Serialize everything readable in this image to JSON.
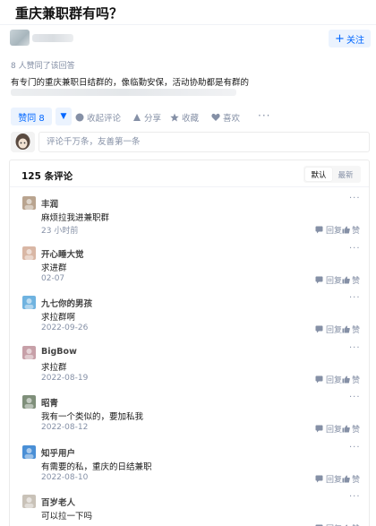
{
  "question": {
    "title": "重庆兼职群有吗？"
  },
  "author": {
    "follow_label": "关注"
  },
  "answer": {
    "vote_summary": "8 人赞同了该回答",
    "text": "有专门的重庆兼职日结群的，像临勤安保，活动协助都是有群的"
  },
  "actions": {
    "upvote_label": "赞同 8",
    "downvote_symbol": "▼",
    "collapse_comments": "收起评论",
    "share": "分享",
    "favorite": "收藏",
    "like": "喜欢",
    "more": "···"
  },
  "comment_box": {
    "placeholder": "评论千万条，友善第一条"
  },
  "comments_section": {
    "count_label": "125 条评论",
    "sort_default": "默认",
    "sort_latest": "最新"
  },
  "comment_actions": {
    "reply": "回复",
    "like": "赞",
    "more": "···"
  },
  "comments": [
    {
      "author": "丰润",
      "text": "麻烦拉我进兼职群",
      "time": "23 小时前"
    },
    {
      "author": "开心睡大觉",
      "text": "求进群",
      "time": "02-07"
    },
    {
      "author": "九七你的男孩",
      "text": "求拉群啊",
      "time": "2022-09-26"
    },
    {
      "author": "BigBow",
      "text": "求拉群",
      "time": "2022-08-19"
    },
    {
      "author": "昭青",
      "text": "我有一个类似的，要加私我",
      "time": "2022-08-12"
    },
    {
      "author": "知乎用户",
      "text": "有需要的私，重庆的日结兼职",
      "time": "2022-08-10"
    },
    {
      "author": "百岁老人",
      "text": "可以拉一下吗",
      "time": ""
    }
  ],
  "colors": {
    "accent": "#0066ff",
    "muted": "#8590a6",
    "accent_bg": "#ebf3fe"
  }
}
